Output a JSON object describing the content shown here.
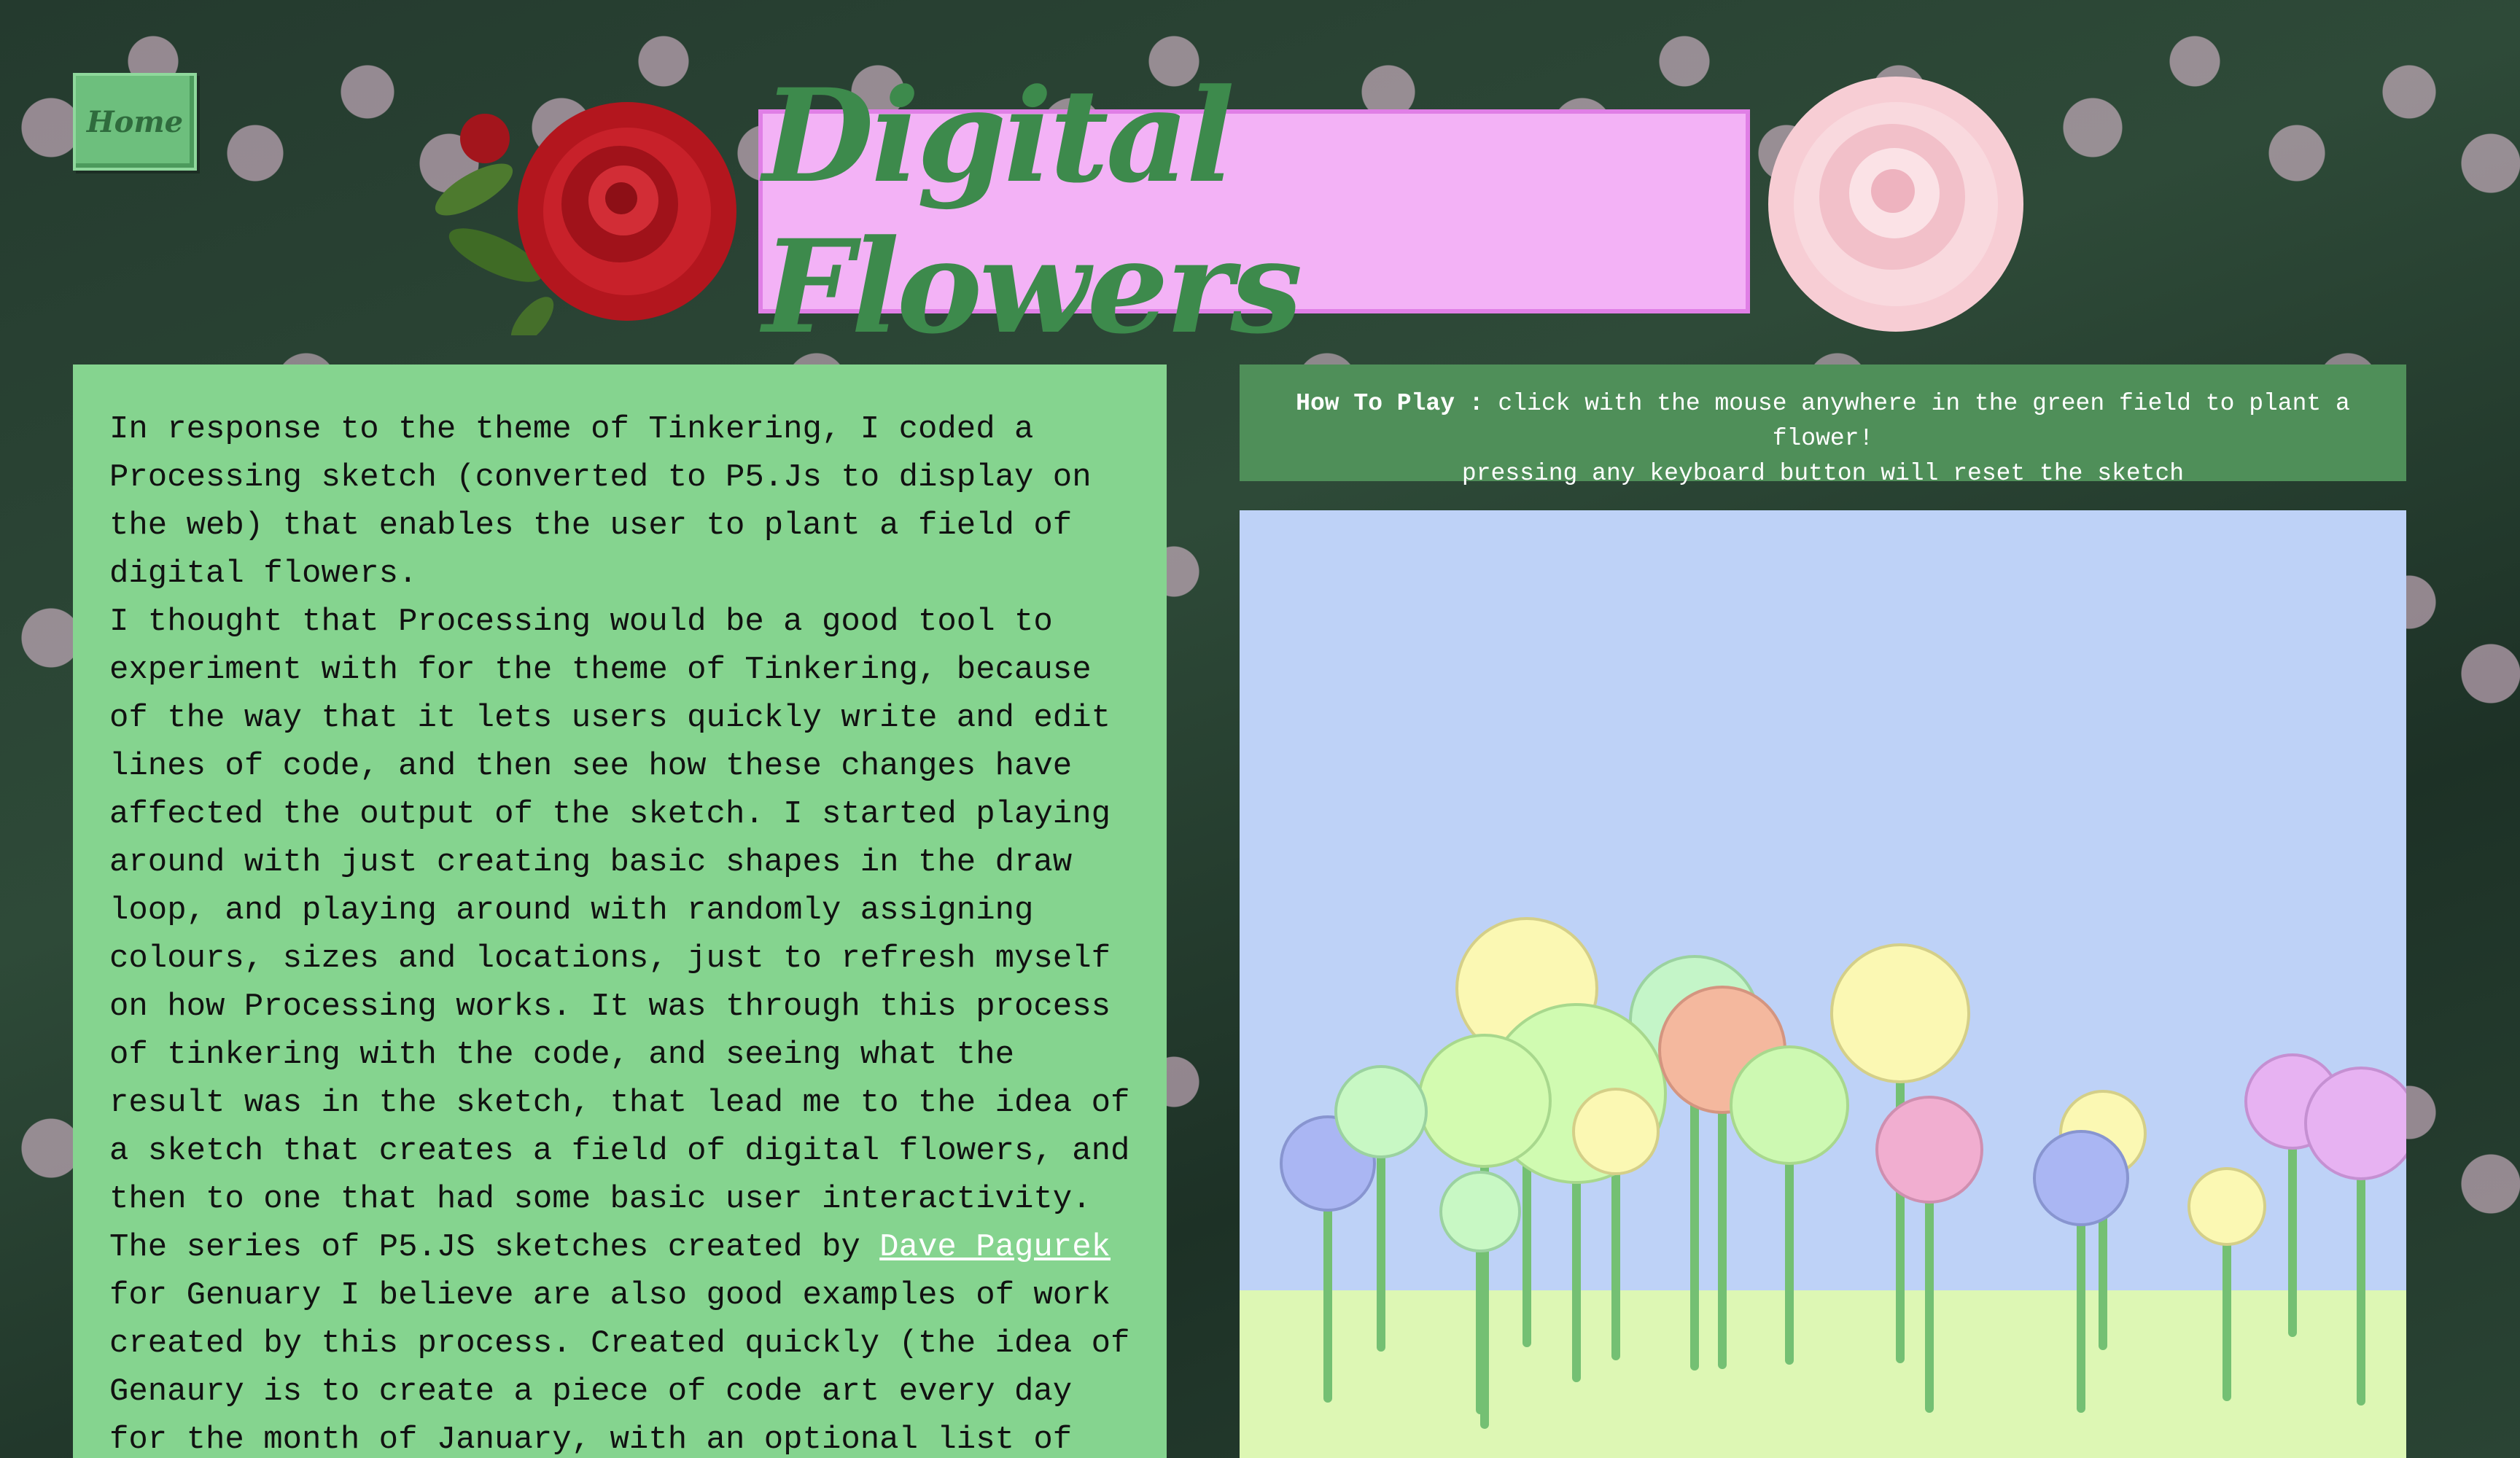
{
  "nav": {
    "home_label": "Home"
  },
  "header": {
    "title": "Digital Flowers"
  },
  "about": {
    "p1": "In response to the theme of Tinkering, I coded a Processing sketch (converted to P5.Js to display on the web) that enables the user to plant a field of digital flowers.",
    "p2": "I thought that Processing would be a good tool to experiment with for the theme of Tinkering, because of the way that it lets users quickly write and edit lines of code, and then see how these changes have affected the output of the sketch. I started playing around with just creating basic shapes in the draw loop, and playing around with randomly assigning colours, sizes and locations, just to refresh myself on how Processing works. It was through this process of tinkering with the code, and seeing what the result was in the sketch, that lead me to the idea of a sketch that creates a field of digital flowers, and then to one that had some basic user interactivity.",
    "p3_before": "The series of P5.JS sketches created by ",
    "p3_link": "Dave Pagurek",
    "p3_after": " for Genuary I believe are also good examples of work created by this process. Created quickly (the idea of Genaury is to create a piece of code art every day for the month of January, with an optional list of"
  },
  "howto": {
    "label": "How To Play :",
    "line1": " click with the mouse anywhere in the green field to plant a flower!",
    "line2": "pressing any keyboard button will reset the sketch"
  },
  "sketch": {
    "sky_color": "#bed2f7",
    "ground_color": "#ddf7b4",
    "stem_color": "#74c073",
    "flowers": [
      {
        "color": "#fbf8b3",
        "stroke": "#d4cf88"
      },
      {
        "color": "#c4f5c8",
        "stroke": "#9bd2a0"
      },
      {
        "color": "#aab6f3",
        "stroke": "#8895d0"
      },
      {
        "color": "#d0fbb1",
        "stroke": "#a8d88d"
      },
      {
        "color": "#f4b89e",
        "stroke": "#d49580"
      },
      {
        "color": "#fbf8b3",
        "stroke": "#d4cf88"
      },
      {
        "color": "#d3fbb0",
        "stroke": "#a8d88d"
      },
      {
        "color": "#cdf9b2",
        "stroke": "#a8d88d"
      },
      {
        "color": "#fbf8b3",
        "stroke": "#d4cf88"
      },
      {
        "color": "#f1aed0",
        "stroke": "#cf8fb0"
      },
      {
        "color": "#fbf8b3",
        "stroke": "#d4cf88"
      },
      {
        "color": "#aab6f3",
        "stroke": "#8895d0"
      },
      {
        "color": "#c8f8c4",
        "stroke": "#9bd2a0"
      },
      {
        "color": "#e7b2f2",
        "stroke": "#c590d2"
      },
      {
        "color": "#e7b2f2",
        "stroke": "#c590d2"
      },
      {
        "color": "#c8f8c4",
        "stroke": "#9bd2a0"
      }
    ]
  }
}
